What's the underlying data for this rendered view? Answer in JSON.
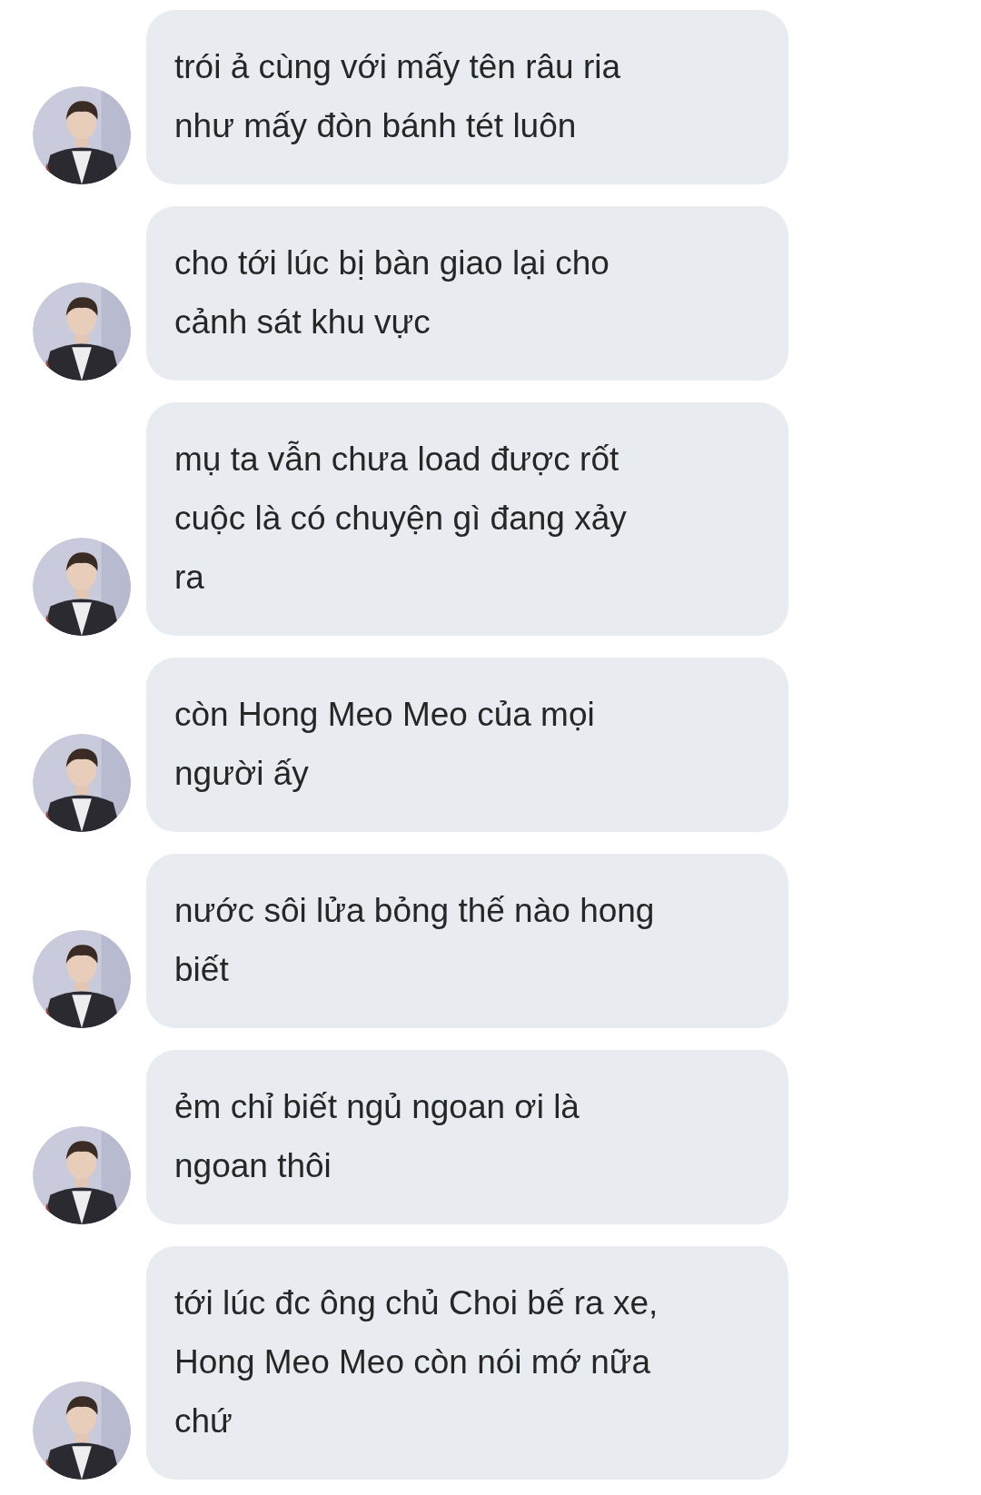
{
  "messages": [
    {
      "text": "trói ả cùng với mấy tên râu ria\nnhư mấy đòn bánh tét luôn"
    },
    {
      "text": "cho tới lúc bị bàn giao lại cho\ncảnh sát khu vực"
    },
    {
      "text": "mụ ta vẫn chưa load được rốt\ncuộc là có chuyện gì đang xảy\nra"
    },
    {
      "text": "còn Hong Meo Meo của mọi\nngười ấy"
    },
    {
      "text": "nước sôi lửa bỏng thế nào hong\nbiết"
    },
    {
      "text": "ẻm chỉ biết ngủ ngoan ơi là\nngoan thôi"
    },
    {
      "text": "tới lúc đc ông chủ Choi bế ra xe,\nHong Meo Meo còn nói mớ nữa\nchứ"
    }
  ]
}
